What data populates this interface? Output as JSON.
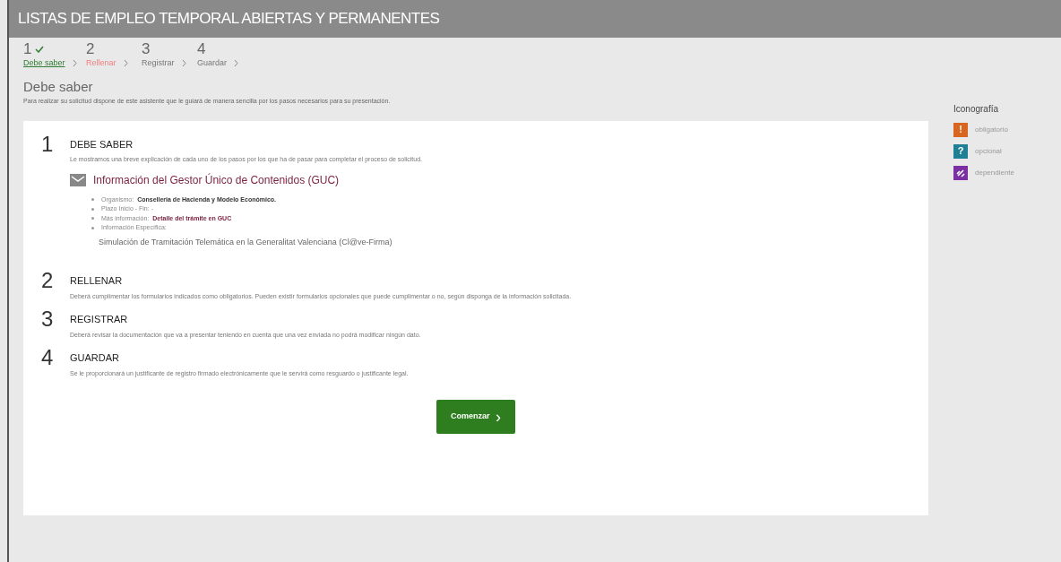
{
  "header": {
    "title": "LISTAS DE EMPLEO TEMPORAL ABIERTAS Y PERMANENTES"
  },
  "wizard_steps": [
    {
      "number": "1",
      "label": "Debe saber",
      "done": true,
      "selected": false
    },
    {
      "number": "2",
      "label": "Rellenar",
      "done": false,
      "selected": true
    },
    {
      "number": "3",
      "label": "Registrar",
      "done": false,
      "selected": false
    },
    {
      "number": "4",
      "label": "Guardar",
      "done": false,
      "selected": false
    }
  ],
  "page": {
    "title": "Debe saber",
    "description": "Para realizar su solicitud dispone de este asistente que le guiará de manera sencilla por los pasos necesarios para su presentación."
  },
  "sections": [
    {
      "number": "1",
      "title": "DEBE SABER",
      "text": "Le mostramos una breve explicación de cada uno de los pasos por los que ha de pasar para completar el proceso de solicitud.",
      "info": {
        "title": "Información del Gestor Único de Contenidos (GUC)",
        "items": [
          {
            "kind": "bold",
            "label": "Organismo:",
            "value": "Conselleria de Hacienda y Modelo Económico."
          },
          {
            "kind": "plain",
            "label": "Plazo Inicio - Fin: -"
          },
          {
            "kind": "link",
            "label": "Más información:",
            "value": "Detalle del trámite en GUC"
          },
          {
            "kind": "plain",
            "label": "Información Específica:"
          }
        ],
        "specific": "Simulación de Tramitación Telemática en la Generalitat Valenciana (Cl@ve-Firma)"
      }
    },
    {
      "number": "2",
      "title": "RELLENAR",
      "text": "Deberá cumplimentar los formularios indicados como obligatorios. Pueden existir formularios opcionales que puede cumplimentar o no, según disponga de la información solicitada."
    },
    {
      "number": "3",
      "title": "REGISTRAR",
      "text": "Deberá revisar la documentación que va a presentar teniendo en cuenta que una vez enviada no podrá modificar ningún dato."
    },
    {
      "number": "4",
      "title": "GUARDAR",
      "text": "Se le proporcionará un justificante de registro firmado electrónicamente que le servirá como resguardo o justificante legal."
    }
  ],
  "start_button": {
    "label": "Comenzar",
    "symbol": "›"
  },
  "legend": {
    "title": "Iconografía",
    "items": [
      {
        "kind": "required",
        "symbol": "!",
        "label": "obligatorio",
        "color": "#d9661f"
      },
      {
        "kind": "optional",
        "symbol": "?",
        "label": "opcional",
        "color": "#1f7f94"
      },
      {
        "kind": "dependent",
        "label": "dependiente",
        "color": "#7b2fa3"
      }
    ]
  }
}
